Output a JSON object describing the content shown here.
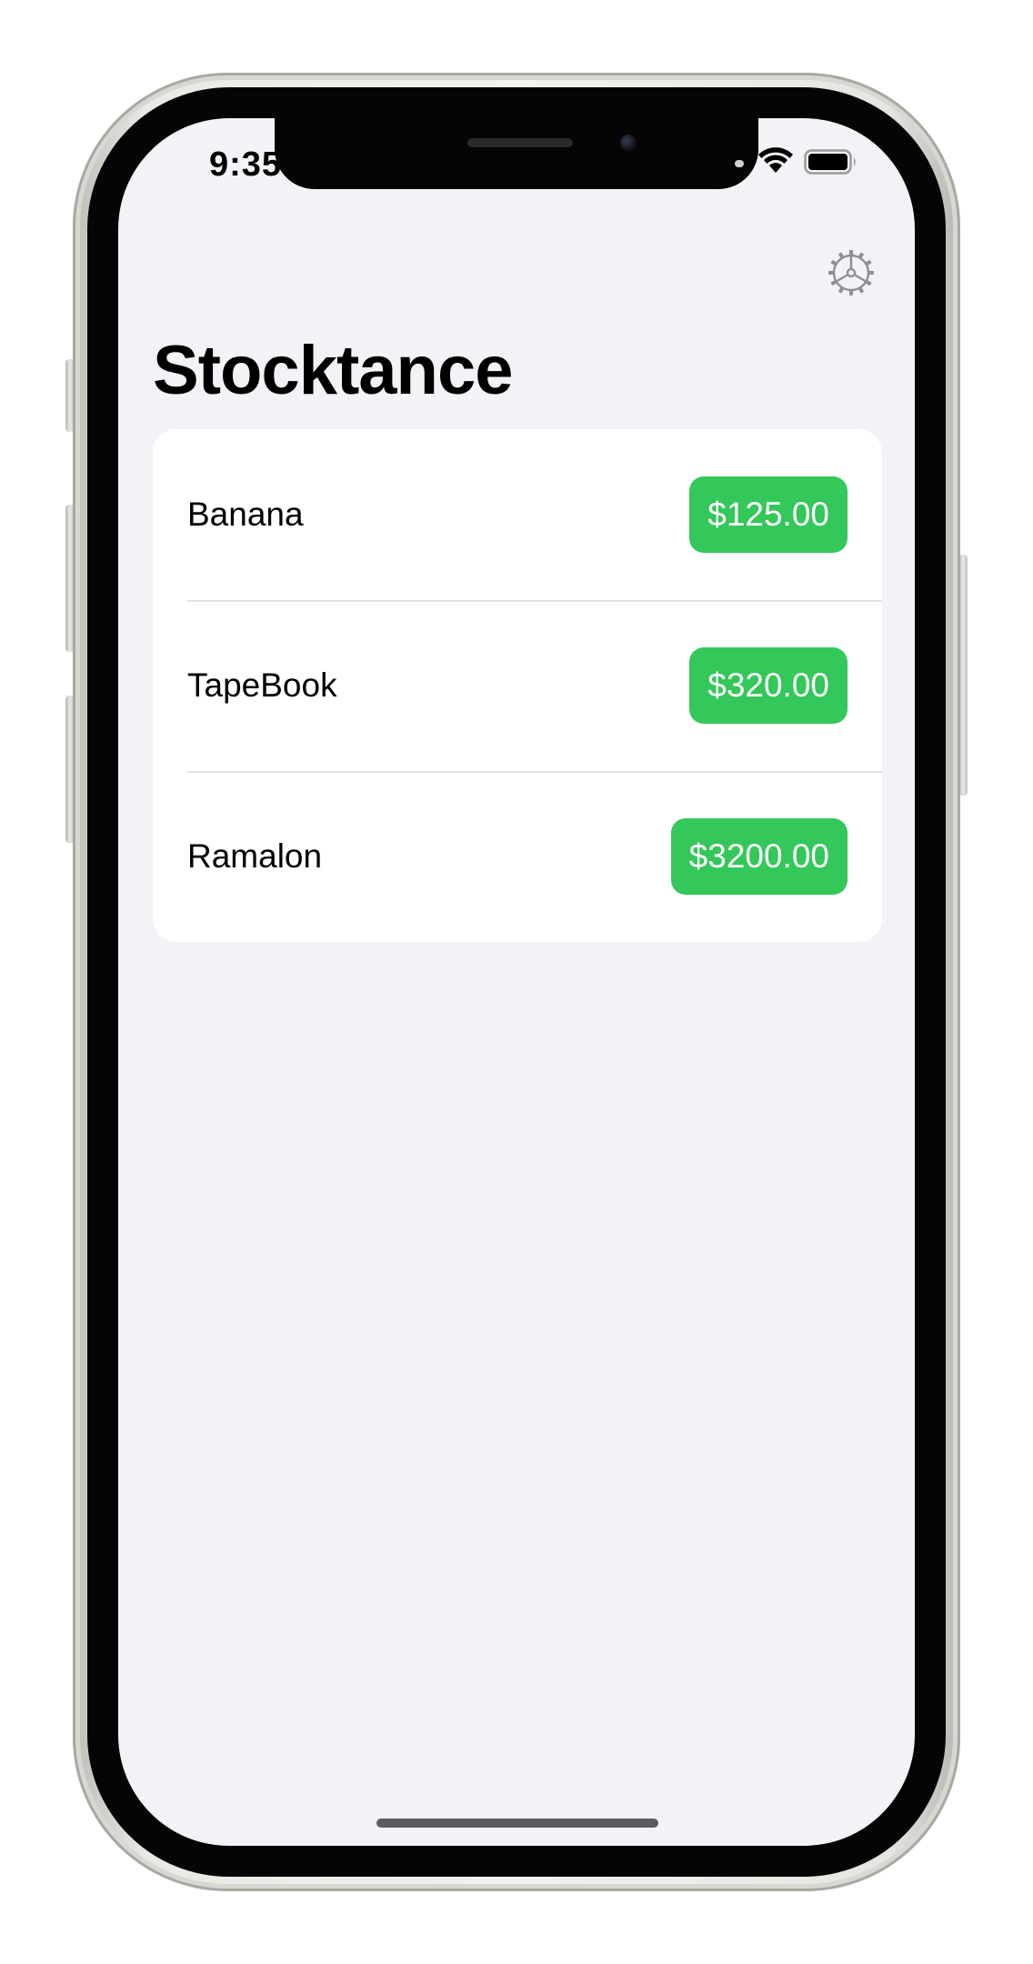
{
  "status_bar": {
    "time": "9:35",
    "wifi_icon": "wifi-icon",
    "battery_icon": "battery-icon"
  },
  "toolbar": {
    "settings_icon": "gear-icon"
  },
  "page": {
    "title": "Stocktance"
  },
  "stocks": [
    {
      "name": "Banana",
      "price": "$125.00"
    },
    {
      "name": "TapeBook",
      "price": "$320.00"
    },
    {
      "name": "Ramalon",
      "price": "$3200.00"
    }
  ],
  "colors": {
    "background": "#f2f2f7",
    "card": "#ffffff",
    "price_badge": "#34c759",
    "text": "#000000",
    "icon_gray": "#8e8e93"
  }
}
